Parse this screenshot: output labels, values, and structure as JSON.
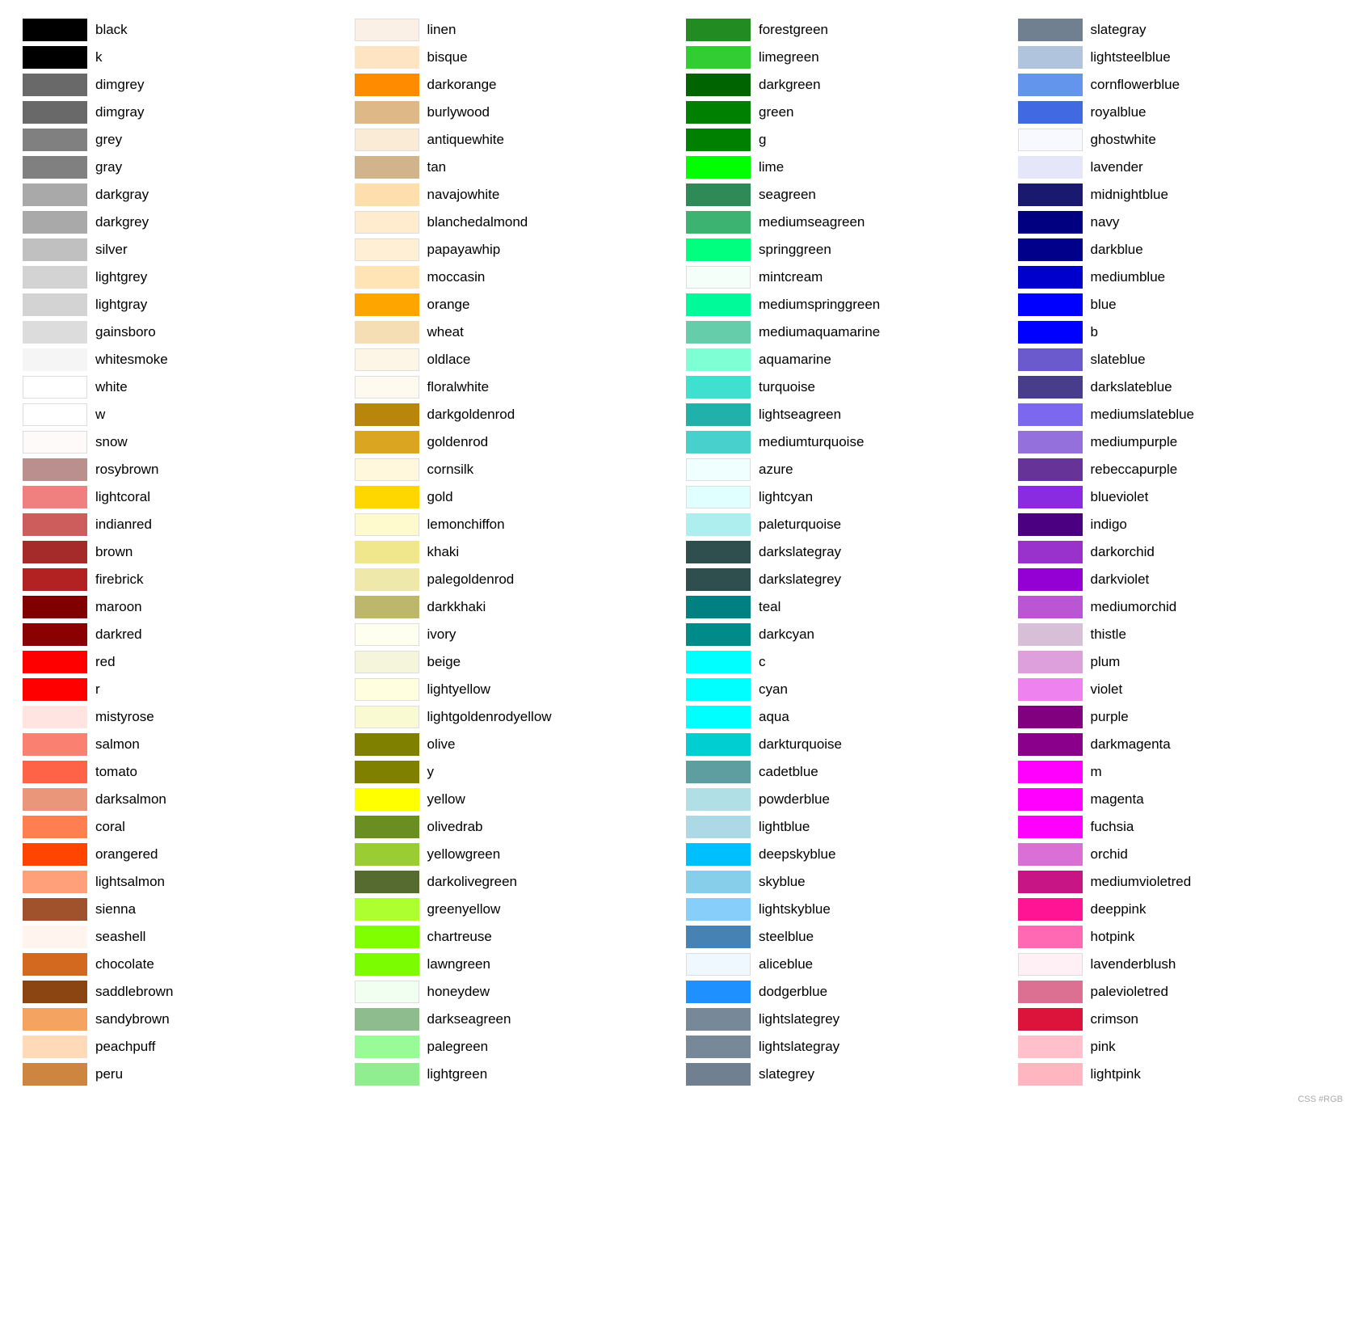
{
  "columns": [
    [
      {
        "name": "black",
        "color": "#000000"
      },
      {
        "name": "k",
        "color": "#000000"
      },
      {
        "name": "dimgrey",
        "color": "#696969"
      },
      {
        "name": "dimgray",
        "color": "#696969"
      },
      {
        "name": "grey",
        "color": "#808080"
      },
      {
        "name": "gray",
        "color": "#808080"
      },
      {
        "name": "darkgray",
        "color": "#a9a9a9"
      },
      {
        "name": "darkgrey",
        "color": "#a9a9a9"
      },
      {
        "name": "silver",
        "color": "#c0c0c0"
      },
      {
        "name": "lightgrey",
        "color": "#d3d3d3"
      },
      {
        "name": "lightgray",
        "color": "#d3d3d3"
      },
      {
        "name": "gainsboro",
        "color": "#dcdcdc"
      },
      {
        "name": "whitesmoke",
        "color": "#f5f5f5"
      },
      {
        "name": "white",
        "color": "#ffffff"
      },
      {
        "name": "w",
        "color": "#ffffff"
      },
      {
        "name": "snow",
        "color": "#fffafa"
      },
      {
        "name": "rosybrown",
        "color": "#bc8f8f"
      },
      {
        "name": "lightcoral",
        "color": "#f08080"
      },
      {
        "name": "indianred",
        "color": "#cd5c5c"
      },
      {
        "name": "brown",
        "color": "#a52a2a"
      },
      {
        "name": "firebrick",
        "color": "#b22222"
      },
      {
        "name": "maroon",
        "color": "#800000"
      },
      {
        "name": "darkred",
        "color": "#8b0000"
      },
      {
        "name": "red",
        "color": "#ff0000"
      },
      {
        "name": "r",
        "color": "#ff0000"
      },
      {
        "name": "mistyrose",
        "color": "#ffe4e1"
      },
      {
        "name": "salmon",
        "color": "#fa8072"
      },
      {
        "name": "tomato",
        "color": "#ff6347"
      },
      {
        "name": "darksalmon",
        "color": "#e9967a"
      },
      {
        "name": "coral",
        "color": "#ff7f50"
      },
      {
        "name": "orangered",
        "color": "#ff4500"
      },
      {
        "name": "lightsalmon",
        "color": "#ffa07a"
      },
      {
        "name": "sienna",
        "color": "#a0522d"
      },
      {
        "name": "seashell",
        "color": "#fff5ee"
      },
      {
        "name": "chocolate",
        "color": "#d2691e"
      },
      {
        "name": "saddlebrown",
        "color": "#8b4513"
      },
      {
        "name": "sandybrown",
        "color": "#f4a460"
      },
      {
        "name": "peachpuff",
        "color": "#ffdab9"
      },
      {
        "name": "peru",
        "color": "#cd853f"
      }
    ],
    [
      {
        "name": "linen",
        "color": "#faf0e6"
      },
      {
        "name": "bisque",
        "color": "#ffe4c4"
      },
      {
        "name": "darkorange",
        "color": "#ff8c00"
      },
      {
        "name": "burlywood",
        "color": "#deb887"
      },
      {
        "name": "antiquewhite",
        "color": "#faebd7"
      },
      {
        "name": "tan",
        "color": "#d2b48c"
      },
      {
        "name": "navajowhite",
        "color": "#ffdead"
      },
      {
        "name": "blanchedalmond",
        "color": "#ffebcd"
      },
      {
        "name": "papayawhip",
        "color": "#ffefd5"
      },
      {
        "name": "moccasin",
        "color": "#ffe4b5"
      },
      {
        "name": "orange",
        "color": "#ffa500"
      },
      {
        "name": "wheat",
        "color": "#f5deb3"
      },
      {
        "name": "oldlace",
        "color": "#fdf5e6"
      },
      {
        "name": "floralwhite",
        "color": "#fffaf0"
      },
      {
        "name": "darkgoldenrod",
        "color": "#b8860b"
      },
      {
        "name": "goldenrod",
        "color": "#daa520"
      },
      {
        "name": "cornsilk",
        "color": "#fff8dc"
      },
      {
        "name": "gold",
        "color": "#ffd700"
      },
      {
        "name": "lemonchiffon",
        "color": "#fffacd"
      },
      {
        "name": "khaki",
        "color": "#f0e68c"
      },
      {
        "name": "palegoldenrod",
        "color": "#eee8aa"
      },
      {
        "name": "darkkhaki",
        "color": "#bdb76b"
      },
      {
        "name": "ivory",
        "color": "#fffff0"
      },
      {
        "name": "beige",
        "color": "#f5f5dc"
      },
      {
        "name": "lightyellow",
        "color": "#ffffe0"
      },
      {
        "name": "lightgoldenrodyellow",
        "color": "#fafad2"
      },
      {
        "name": "olive",
        "color": "#808000"
      },
      {
        "name": "y",
        "color": "#808000"
      },
      {
        "name": "yellow",
        "color": "#ffff00"
      },
      {
        "name": "olivedrab",
        "color": "#6b8e23"
      },
      {
        "name": "yellowgreen",
        "color": "#9acd32"
      },
      {
        "name": "darkolivegreen",
        "color": "#556b2f"
      },
      {
        "name": "greenyellow",
        "color": "#adff2f"
      },
      {
        "name": "chartreuse",
        "color": "#7fff00"
      },
      {
        "name": "lawngreen",
        "color": "#7cfc00"
      },
      {
        "name": "honeydew",
        "color": "#f0fff0"
      },
      {
        "name": "darkseagreen",
        "color": "#8fbc8f"
      },
      {
        "name": "palegreen",
        "color": "#98fb98"
      },
      {
        "name": "lightgreen",
        "color": "#90ee90"
      }
    ],
    [
      {
        "name": "forestgreen",
        "color": "#228b22"
      },
      {
        "name": "limegreen",
        "color": "#32cd32"
      },
      {
        "name": "darkgreen",
        "color": "#006400"
      },
      {
        "name": "green",
        "color": "#008000"
      },
      {
        "name": "g",
        "color": "#008000"
      },
      {
        "name": "lime",
        "color": "#00ff00"
      },
      {
        "name": "seagreen",
        "color": "#2e8b57"
      },
      {
        "name": "mediumseagreen",
        "color": "#3cb371"
      },
      {
        "name": "springgreen",
        "color": "#00ff7f"
      },
      {
        "name": "mintcream",
        "color": "#f5fffa"
      },
      {
        "name": "mediumspringgreen",
        "color": "#00fa9a"
      },
      {
        "name": "mediumaquamarine",
        "color": "#66cdaa"
      },
      {
        "name": "aquamarine",
        "color": "#7fffd4"
      },
      {
        "name": "turquoise",
        "color": "#40e0d0"
      },
      {
        "name": "lightseagreen",
        "color": "#20b2aa"
      },
      {
        "name": "mediumturquoise",
        "color": "#48d1cc"
      },
      {
        "name": "azure",
        "color": "#f0ffff"
      },
      {
        "name": "lightcyan",
        "color": "#e0ffff"
      },
      {
        "name": "paleturquoise",
        "color": "#afeeee"
      },
      {
        "name": "darkslategray",
        "color": "#2f4f4f"
      },
      {
        "name": "darkslategrey",
        "color": "#2f4f4f"
      },
      {
        "name": "teal",
        "color": "#008080"
      },
      {
        "name": "darkcyan",
        "color": "#008b8b"
      },
      {
        "name": "c",
        "color": "#00ffff"
      },
      {
        "name": "cyan",
        "color": "#00ffff"
      },
      {
        "name": "aqua",
        "color": "#00ffff"
      },
      {
        "name": "darkturquoise",
        "color": "#00ced1"
      },
      {
        "name": "cadetblue",
        "color": "#5f9ea0"
      },
      {
        "name": "powderblue",
        "color": "#b0e0e6"
      },
      {
        "name": "lightblue",
        "color": "#add8e6"
      },
      {
        "name": "deepskyblue",
        "color": "#00bfff"
      },
      {
        "name": "skyblue",
        "color": "#87ceeb"
      },
      {
        "name": "lightskyblue",
        "color": "#87cefa"
      },
      {
        "name": "steelblue",
        "color": "#4682b4"
      },
      {
        "name": "aliceblue",
        "color": "#f0f8ff"
      },
      {
        "name": "dodgerblue",
        "color": "#1e90ff"
      },
      {
        "name": "lightslategrey",
        "color": "#778899"
      },
      {
        "name": "lightslategray",
        "color": "#778899"
      },
      {
        "name": "slategrey",
        "color": "#708090"
      }
    ],
    [
      {
        "name": "slategray",
        "color": "#708090"
      },
      {
        "name": "lightsteelblue",
        "color": "#b0c4de"
      },
      {
        "name": "cornflowerblue",
        "color": "#6495ed"
      },
      {
        "name": "royalblue",
        "color": "#4169e1"
      },
      {
        "name": "ghostwhite",
        "color": "#f8f8ff"
      },
      {
        "name": "lavender",
        "color": "#e6e6fa"
      },
      {
        "name": "midnightblue",
        "color": "#191970"
      },
      {
        "name": "navy",
        "color": "#000080"
      },
      {
        "name": "darkblue",
        "color": "#00008b"
      },
      {
        "name": "mediumblue",
        "color": "#0000cd"
      },
      {
        "name": "blue",
        "color": "#0000ff"
      },
      {
        "name": "b",
        "color": "#0000ff"
      },
      {
        "name": "slateblue",
        "color": "#6a5acd"
      },
      {
        "name": "darkslateblue",
        "color": "#483d8b"
      },
      {
        "name": "mediumslateblue",
        "color": "#7b68ee"
      },
      {
        "name": "mediumpurple",
        "color": "#9370db"
      },
      {
        "name": "rebeccapurple",
        "color": "#663399"
      },
      {
        "name": "blueviolet",
        "color": "#8a2be2"
      },
      {
        "name": "indigo",
        "color": "#4b0082"
      },
      {
        "name": "darkorchid",
        "color": "#9932cc"
      },
      {
        "name": "darkviolet",
        "color": "#9400d3"
      },
      {
        "name": "mediumorchid",
        "color": "#ba55d3"
      },
      {
        "name": "thistle",
        "color": "#d8bfd8"
      },
      {
        "name": "plum",
        "color": "#dda0dd"
      },
      {
        "name": "violet",
        "color": "#ee82ee"
      },
      {
        "name": "purple",
        "color": "#800080"
      },
      {
        "name": "darkmagenta",
        "color": "#8b008b"
      },
      {
        "name": "m",
        "color": "#ff00ff"
      },
      {
        "name": "magenta",
        "color": "#ff00ff"
      },
      {
        "name": "fuchsia",
        "color": "#ff00ff"
      },
      {
        "name": "orchid",
        "color": "#da70d6"
      },
      {
        "name": "mediumvioletred",
        "color": "#c71585"
      },
      {
        "name": "deeppink",
        "color": "#ff1493"
      },
      {
        "name": "hotpink",
        "color": "#ff69b4"
      },
      {
        "name": "lavenderblush",
        "color": "#fff0f5"
      },
      {
        "name": "palevioletred",
        "color": "#db7093"
      },
      {
        "name": "crimson",
        "color": "#dc143c"
      },
      {
        "name": "pink",
        "color": "#ffc0cb"
      },
      {
        "name": "lightpink",
        "color": "#ffb6c1"
      }
    ]
  ],
  "watermark": "CSS #RGB"
}
